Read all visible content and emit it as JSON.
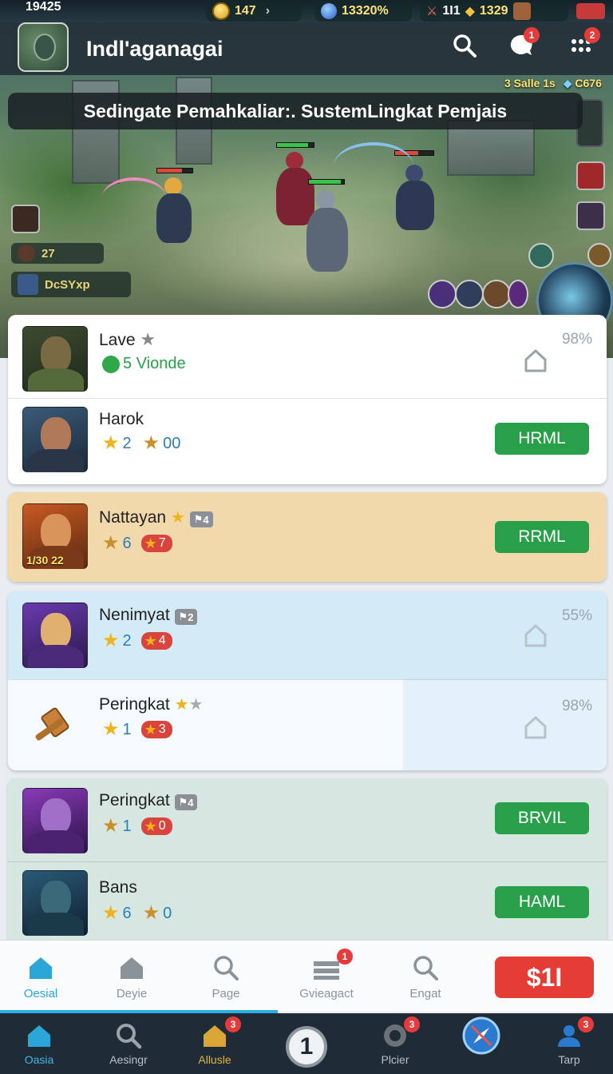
{
  "status": {
    "time": "19425",
    "coins": "147",
    "gems": "13320%",
    "stat_a": "1I1",
    "stat_b": "1329"
  },
  "header": {
    "title": "Indl'aganagai",
    "search_badge": "",
    "chat_badge": "1",
    "menu_badge": "2"
  },
  "scene": {
    "mini_stat": "3 Salle 1s",
    "mini_stat_b": "C676",
    "banner": "Sedingate Pemahkaliar:. SustemLingkat Pemjais",
    "player_chip_1": "27",
    "player_chip_2": "DcSYxp"
  },
  "list": {
    "groups": [
      {
        "rows": [
          {
            "name": "Lave",
            "sub": "5 Vionde",
            "pct": "98%"
          },
          {
            "name": "Harok",
            "s1": "2",
            "s2": "00",
            "button": "HRML"
          }
        ]
      },
      {
        "rows": [
          {
            "name": "Nattayan",
            "badge": "4",
            "s1": "6",
            "s2": "7",
            "button": "RRML",
            "thumb_label": "1/30  22"
          }
        ]
      },
      {
        "rows": [
          {
            "name": "Nenimyat",
            "badge": "2",
            "s1": "2",
            "s2": "4",
            "pct": "55%"
          },
          {
            "name": "Peringkat",
            "s1": "1",
            "s2": "3",
            "pct": "98%"
          }
        ]
      },
      {
        "rows": [
          {
            "name": "Peringkat",
            "badge": "4",
            "s1": "1",
            "s2": "0",
            "button": "BRVIL"
          },
          {
            "name": "Bans",
            "s1": "6",
            "s2": "0",
            "button": "HAML"
          }
        ]
      }
    ]
  },
  "tabbar_top": {
    "tabs": [
      {
        "label": "Oesial"
      },
      {
        "label": "Deyie"
      },
      {
        "label": "Page"
      },
      {
        "label": "Gvieagact",
        "badge": "1"
      },
      {
        "label": "Engat"
      }
    ],
    "buy_label": "$1I"
  },
  "tabbar_bottom": {
    "tabs": [
      {
        "label": "Oasia"
      },
      {
        "label": "Aesingr"
      },
      {
        "label": "Allusle",
        "badge": "3"
      },
      {
        "label": "Plcier",
        "badge": "3"
      },
      {
        "label": ""
      },
      {
        "label": "Tarp",
        "badge": "3"
      }
    ],
    "center": "1"
  },
  "colors": {
    "accent": "#2aa6d8",
    "action_green": "#28a04a",
    "buy_red": "#e53d35",
    "badge_red": "#e63b3b"
  }
}
